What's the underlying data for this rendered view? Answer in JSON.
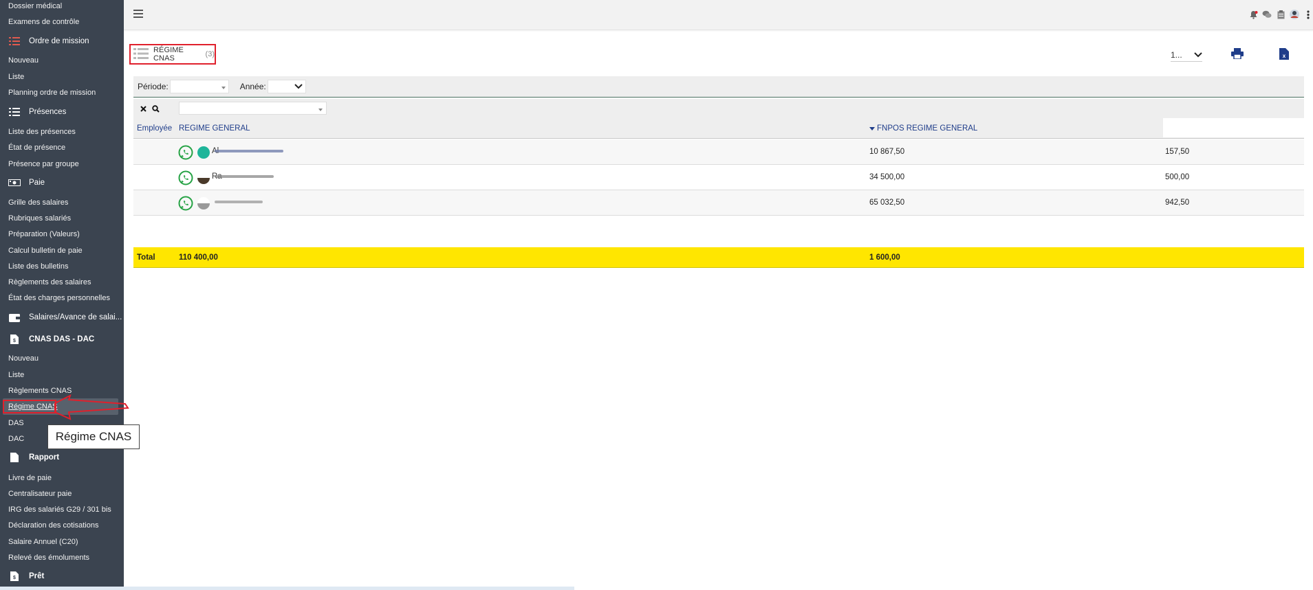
{
  "sidebar": {
    "items_top": [
      "Dossier médical",
      "Examens de contrôle"
    ],
    "mission": {
      "label": "Ordre de mission",
      "items": [
        "Nouveau",
        "Liste",
        "Planning ordre de mission"
      ]
    },
    "presences": {
      "label": "Présences",
      "items": [
        "Liste des présences",
        "État de présence",
        "Présence par groupe"
      ]
    },
    "paie": {
      "label": "Paie",
      "items": [
        "Grille des salaires",
        "Rubriques salariés",
        "Préparation (Valeurs)",
        "Calcul bulletin de paie",
        "Liste des bulletins",
        "Règlements des salaires",
        "État des charges personnelles"
      ]
    },
    "salaires": {
      "label": "Salaires/Avance de salai..."
    },
    "cnas": {
      "label": "CNAS DAS - DAC",
      "items": [
        "Nouveau",
        "Liste",
        "Règlements CNAS",
        "Régime CNAS",
        "DAS",
        "DAC"
      ]
    },
    "rapport": {
      "label": "Rapport",
      "items": [
        "Livre de paie",
        "Centralisateur paie",
        "IRG des salariés G29 / 301 bis",
        "Déclaration des cotisations",
        "Salaire Annuel (C20)",
        "Relevé des émoluments"
      ]
    },
    "pret": {
      "label": "Prêt"
    }
  },
  "tooltip": "Régime CNAS",
  "page": {
    "title": "RÉGIME CNAS",
    "count": "(3)",
    "page_select": "1..."
  },
  "filters": {
    "periode_label": "Période:",
    "periode_value": "",
    "annee_label": "Année:",
    "annee_value": ""
  },
  "table": {
    "columns": [
      "Employée",
      "REGIME GENERAL",
      "FNPOS REGIME GENERAL"
    ],
    "rows": [
      {
        "name": "Al",
        "regime_general": "10 867,50",
        "fnpos": "157,50"
      },
      {
        "name": "Ra",
        "regime_general": "34 500,00",
        "fnpos": "500,00"
      },
      {
        "name": "",
        "regime_general": "65 032,50",
        "fnpos": "942,50"
      }
    ],
    "total": {
      "label": "Total",
      "regime_general": "110 400,00",
      "fnpos": "1 600,00"
    }
  },
  "colors": {
    "sidebar_bg": "#3b4450",
    "total_bg": "#ffe600",
    "header_text": "#1f3d8a",
    "annotation": "#e0202c",
    "whatsapp": "#25a244"
  }
}
